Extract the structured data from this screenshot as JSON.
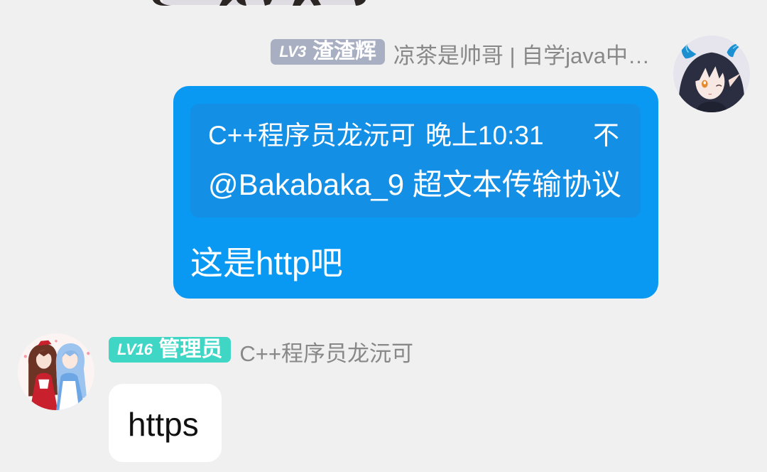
{
  "theme": {
    "background": "#f0f0f0",
    "name_color": "#888888",
    "self_bubble_color": "#0a99f2",
    "quote_color": "#138fe6",
    "self_text_color": "#ffffff",
    "other_bubble_color": "#ffffff",
    "other_text_color": "#111111"
  },
  "messages": [
    {
      "level": "LV3",
      "title": "渣渣辉",
      "badge_color": "#a9afc2",
      "name": "凉茶是帅哥 | 自学java中…",
      "reply": {
        "author": "C++程序员龙沅可",
        "time": "晚上10:31",
        "text_start": "不",
        "text": "@Bakabaka_9 超文本传输协议"
      },
      "text": "这是http吧"
    },
    {
      "level": "LV16",
      "title": "管理员",
      "badge_color": "#3fd6c5",
      "name": "C++程序员龙沅可",
      "text": "https"
    }
  ]
}
